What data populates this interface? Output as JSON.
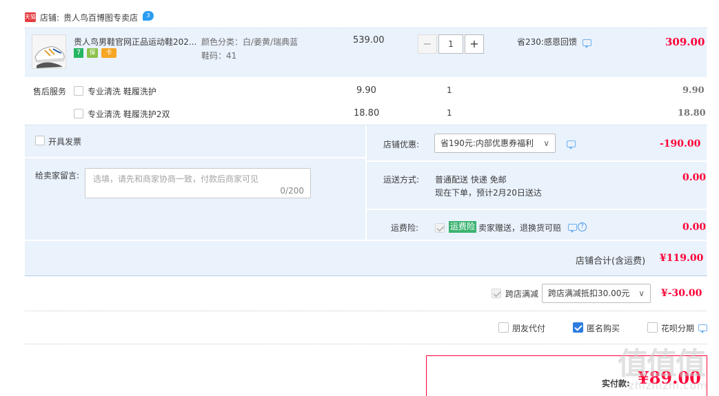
{
  "shop": {
    "badge": "天猫",
    "label": "店铺:",
    "name": "贵人鸟百博图专卖店"
  },
  "product": {
    "title": "贵人鸟男鞋官网正品运动鞋202...",
    "badges": [
      "7",
      "保",
      "卡"
    ],
    "spec_color": "颜色分类：白/姜黄/瑞典蓝",
    "spec_size": "鞋码：41",
    "unit_price": "539.00",
    "quantity": "1",
    "minus_label": "−",
    "plus_label": "+",
    "promo": "省230:感恩回馈",
    "total": "309.00"
  },
  "after_sales": {
    "label": "售后服务",
    "items": [
      {
        "name": "专业清洗 鞋履洗护",
        "price": "9.90",
        "qty": "1",
        "total": "9.90",
        "checked": false
      },
      {
        "name": "专业清洗 鞋履洗护2双",
        "price": "18.80",
        "qty": "1",
        "total": "18.80",
        "checked": false
      }
    ]
  },
  "order_options": {
    "invoice_label": "开具发票",
    "message_label": "给卖家留言:",
    "message_placeholder": "选填，请先和商家协商一致，付款后商家可见",
    "message_counter": "0/200",
    "shop_discount_label": "店铺优惠:",
    "shop_discount_value": "省190元:内部优惠券福利",
    "shop_discount_amount": "-190.00",
    "shipping_label": "运送方式:",
    "shipping_method": "普通配送 快递 免邮",
    "shipping_eta": "现在下单，预计2月20日送达",
    "shipping_amount": "0.00",
    "insurance_label": "运费险:",
    "insurance_tag": "运费险",
    "insurance_text": "卖家赠送，退换货可赔",
    "insurance_amount": "0.00",
    "shop_total_label": "店铺合计(含运费)",
    "shop_total": "¥119.00"
  },
  "cross_shop": {
    "label": "跨店满减",
    "select_value": "跨店满减抵扣30.00元",
    "amount": "¥-30.00"
  },
  "payment_options": {
    "friend_pay": "朋友代付",
    "anonymous": "匿名购买",
    "huabei": "花呗分期"
  },
  "summary": {
    "label": "实付款:",
    "amount": "¥89.00"
  },
  "watermark": {
    "logo": "值值值",
    "url": "zhizhizhi.com"
  },
  "colors": {
    "accent_red": "#ff0036",
    "panel_blue": "#eaf2fc",
    "check_blue": "#2d7de1",
    "insurance_green": "#3cb371"
  }
}
